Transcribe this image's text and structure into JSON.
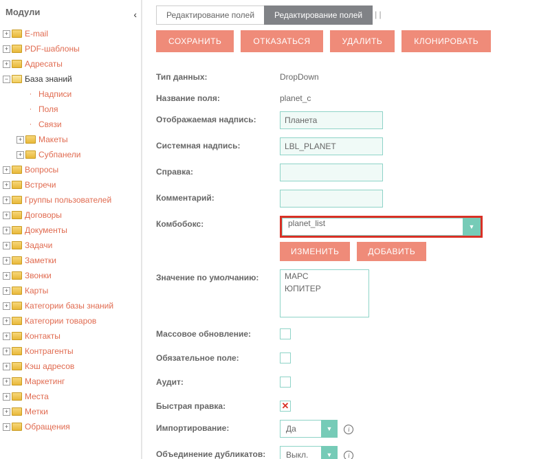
{
  "sidebar": {
    "title": "Модули",
    "items": [
      {
        "label": "E-mail"
      },
      {
        "label": "PDF-шаблоны"
      },
      {
        "label": "Адресаты"
      },
      {
        "label": "База знаний",
        "expanded": true,
        "children": [
          {
            "label": "Надписи",
            "type": "dot"
          },
          {
            "label": "Поля",
            "type": "dot"
          },
          {
            "label": "Связи",
            "type": "dot"
          },
          {
            "label": "Макеты",
            "type": "folder"
          },
          {
            "label": "Субпанели",
            "type": "folder"
          }
        ]
      },
      {
        "label": "Вопросы"
      },
      {
        "label": "Встречи"
      },
      {
        "label": "Группы пользователей"
      },
      {
        "label": "Договоры"
      },
      {
        "label": "Документы"
      },
      {
        "label": "Задачи"
      },
      {
        "label": "Заметки"
      },
      {
        "label": "Звонки"
      },
      {
        "label": "Карты"
      },
      {
        "label": "Категории базы знаний"
      },
      {
        "label": "Категории товаров"
      },
      {
        "label": "Контакты"
      },
      {
        "label": "Контрагенты"
      },
      {
        "label": "Кэш адресов"
      },
      {
        "label": "Маркетинг"
      },
      {
        "label": "Места"
      },
      {
        "label": "Метки"
      },
      {
        "label": "Обращения"
      }
    ]
  },
  "tabs": {
    "t1": "Редактирование полей",
    "t2": "Редактирование полей",
    "extra": "| |"
  },
  "toolbar": {
    "save": "СОХРАНИТЬ",
    "cancel": "ОТКАЗАТЬСЯ",
    "delete": "УДАЛИТЬ",
    "clone": "КЛОНИРОВАТЬ"
  },
  "form": {
    "datatype_label": "Тип данных:",
    "datatype_value": "DropDown",
    "fieldname_label": "Название поля:",
    "fieldname_value": "planet_c",
    "display_label": "Отображаемая надпись:",
    "display_value": "Планета",
    "system_label": "Системная надпись:",
    "system_value": "LBL_PLANET",
    "help_label": "Справка:",
    "comment_label": "Комментарий:",
    "combo_label": "Комбобокс:",
    "combo_value": "planet_list",
    "edit_btn": "ИЗМЕНИТЬ",
    "add_btn": "ДОБАВИТЬ",
    "default_label": "Значение по умолчанию:",
    "default_opt1": "МАРС",
    "default_opt2": "ЮПИТЕР",
    "massupd_label": "Массовое обновление:",
    "required_label": "Обязательное поле:",
    "audit_label": "Аудит:",
    "inline_label": "Быстрая правка:",
    "import_label": "Импортирование:",
    "import_value": "Да",
    "merge_label": "Объединение дубликатов:",
    "merge_value": "Выкл."
  }
}
